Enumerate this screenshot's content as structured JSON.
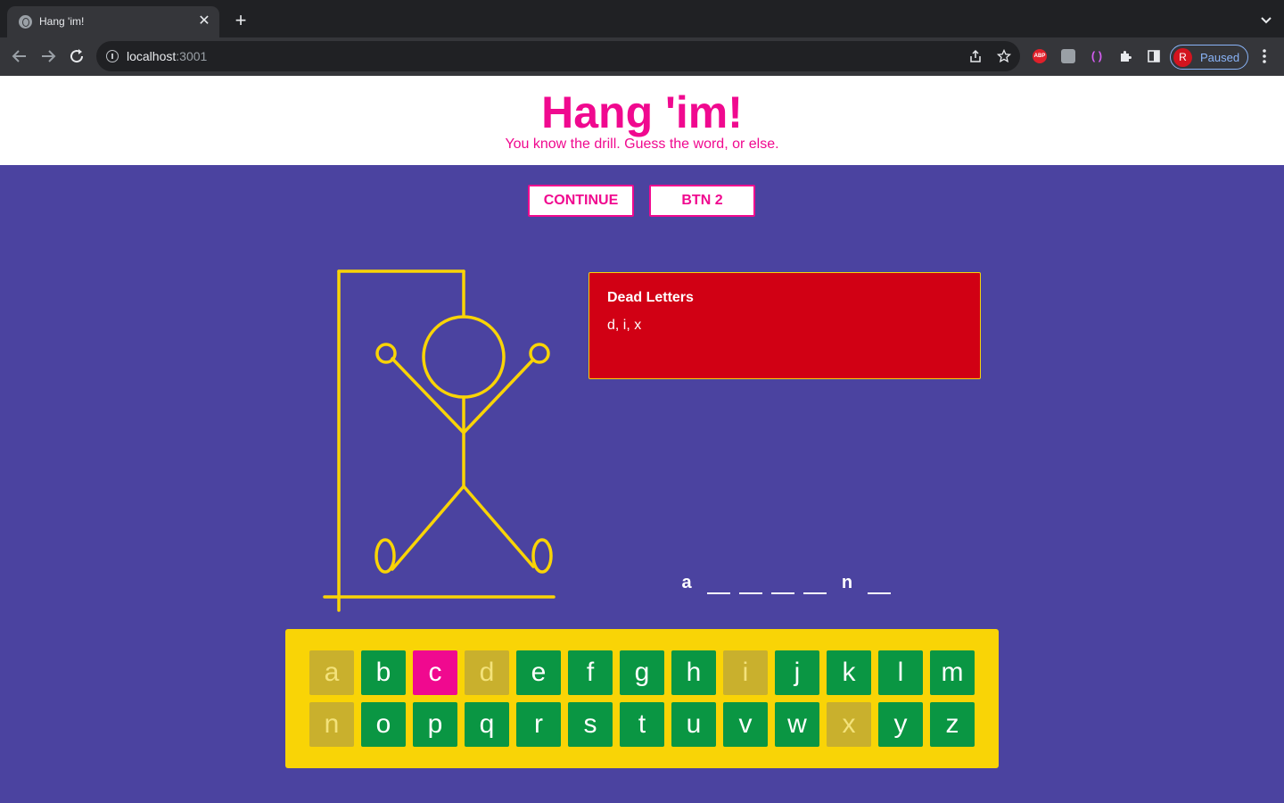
{
  "browser": {
    "tab_title": "Hang 'im!",
    "url_host": "localhost",
    "url_port": ":3001",
    "profile_initial": "R",
    "profile_status": "Paused",
    "extensions": [
      "abp-icon",
      "extension-icon",
      "brackets-icon",
      "puzzle-icon",
      "side-panel-icon"
    ],
    "abp_label": "ABP"
  },
  "header": {
    "title": "Hang 'im!",
    "subtitle": "You know the drill. Guess the word, or else."
  },
  "controls": {
    "continue_label": "CONTINUE",
    "btn2_label": "BTN 2"
  },
  "dead_letters": {
    "title": "Dead Letters",
    "list": "d, i, x"
  },
  "word": [
    "a",
    "",
    "",
    "",
    "",
    "n",
    ""
  ],
  "keyboard": {
    "rows": [
      [
        "a",
        "b",
        "c",
        "d",
        "e",
        "f",
        "g",
        "h",
        "i",
        "j",
        "k",
        "l",
        "m"
      ],
      [
        "n",
        "o",
        "p",
        "q",
        "r",
        "s",
        "t",
        "u",
        "v",
        "w",
        "x",
        "y",
        "z"
      ]
    ],
    "used_correct": [
      "a",
      "n"
    ],
    "used_wrong": [
      "d",
      "i",
      "x"
    ],
    "active": [
      "c"
    ]
  },
  "colors": {
    "brand_pink": "#f0098f",
    "background_purple": "#4b43a0",
    "gallows_yellow": "#f9d406",
    "key_green": "#0a9643",
    "dead_red": "#d10014"
  }
}
